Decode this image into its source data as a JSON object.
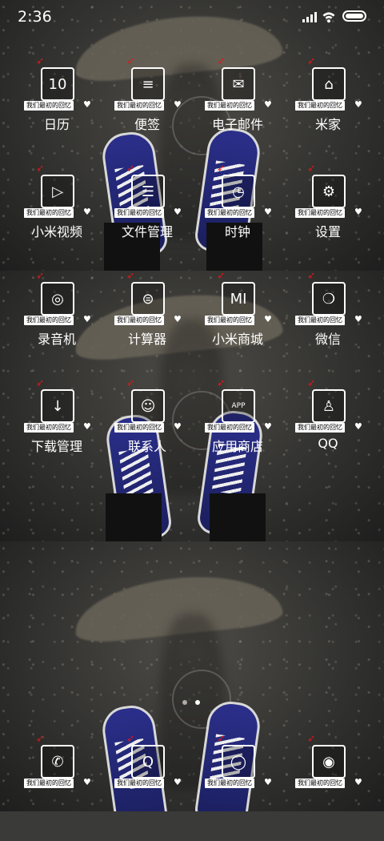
{
  "status_bar": {
    "time": "2:36"
  },
  "ribbon_text": "我们最初的回忆",
  "apps": [
    {
      "label": "日历",
      "icon": "calendar-icon",
      "glyph": "10"
    },
    {
      "label": "便签",
      "icon": "notes-icon",
      "glyph": "≡"
    },
    {
      "label": "电子邮件",
      "icon": "mail-icon",
      "glyph": "✉"
    },
    {
      "label": "米家",
      "icon": "mijia-icon",
      "glyph": "⌂"
    },
    {
      "label": "小米视频",
      "icon": "video-icon",
      "glyph": "▷"
    },
    {
      "label": "文件管理",
      "icon": "file-manager-icon",
      "glyph": "☰"
    },
    {
      "label": "时钟",
      "icon": "clock-icon",
      "glyph": "◷"
    },
    {
      "label": "设置",
      "icon": "settings-icon",
      "glyph": "⚙"
    },
    {
      "label": "录音机",
      "icon": "recorder-icon",
      "glyph": "◎"
    },
    {
      "label": "计算器",
      "icon": "calculator-icon",
      "glyph": "⊜"
    },
    {
      "label": "小米商城",
      "icon": "mi-store-icon",
      "glyph": "MI"
    },
    {
      "label": "微信",
      "icon": "wechat-icon",
      "glyph": "❍"
    },
    {
      "label": "下载管理",
      "icon": "download-icon",
      "glyph": "↓"
    },
    {
      "label": "联系人",
      "icon": "contacts-icon",
      "glyph": "☺"
    },
    {
      "label": "应用商店",
      "icon": "app-store-icon",
      "glyph": "APP"
    },
    {
      "label": "QQ",
      "icon": "qq-icon",
      "glyph": "♙"
    }
  ],
  "dock": [
    {
      "icon": "phone-icon",
      "glyph": "✆"
    },
    {
      "icon": "browser-icon",
      "glyph": "Q"
    },
    {
      "icon": "messages-icon",
      "glyph": "◯"
    },
    {
      "icon": "camera-icon",
      "glyph": "◉"
    }
  ],
  "page_indicator": {
    "pages": 2,
    "current": 2
  }
}
